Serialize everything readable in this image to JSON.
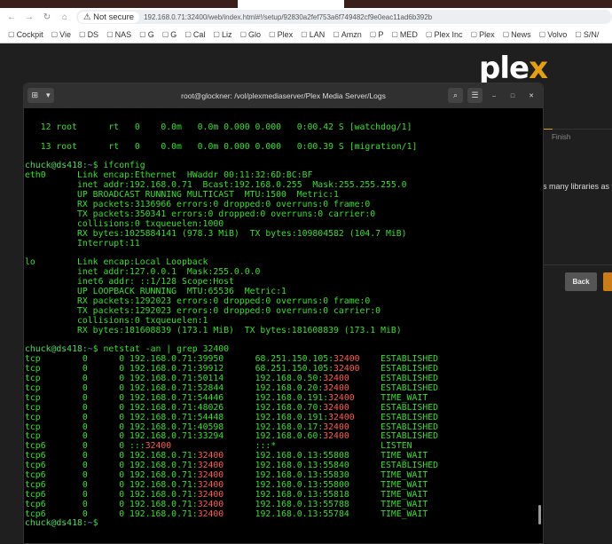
{
  "browser": {
    "not_secure": "Not secure",
    "url": "192.168.0.71:32400/web/index.html#!/setup/92830a2fef753a6f749482cf9e0eac11ad6b392b",
    "bookmarks": [
      "Cockpit",
      "Vie",
      "DS",
      "NAS",
      "G",
      "G",
      "Cal",
      "Liz",
      "Glo",
      "Plex",
      "LAN",
      "Amzn",
      "P",
      "MED",
      "Plex Inc",
      "Plex",
      "News",
      "Volvo",
      "S/N/"
    ]
  },
  "plex": {
    "logo_pre": "ple",
    "logo_x": "x",
    "finish": "Finish",
    "description": "s many libraries as you wa",
    "back": "Back"
  },
  "terminal": {
    "title": "root@glockner: /vol/plexmediaserver/Plex Media Server/Logs",
    "prompt_user": "chuck@ds418",
    "prompt_tilde": ":~$",
    "pre_lines": [
      "",
      "   12 root      rt   0    0.0m   0.0m 0.000 0.000   0:00.42 S [watchdog/1]",
      "",
      "   13 root      rt   0    0.0m   0.0m 0.000 0.000   0:00.39 S [migration/1]",
      ""
    ],
    "cmd1": " ifconfig",
    "ifconfig": [
      "eth0      Link encap:Ethernet  HWaddr 00:11:32:6D:BC:BF",
      "          inet addr:192.168.0.71  Bcast:192.168.0.255  Mask:255.255.255.0",
      "          UP BROADCAST RUNNING MULTICAST  MTU:1500  Metric:1",
      "          RX packets:3136966 errors:0 dropped:0 overruns:0 frame:0",
      "          TX packets:350341 errors:0 dropped:0 overruns:0 carrier:0",
      "          collisions:0 txqueuelen:1000",
      "          RX bytes:1025884141 (978.3 MiB)  TX bytes:109804582 (104.7 MiB)",
      "          Interrupt:11",
      "",
      "lo        Link encap:Local Loopback",
      "          inet addr:127.0.0.1  Mask:255.0.0.0",
      "          inet6 addr: ::1/128 Scope:Host",
      "          UP LOOPBACK RUNNING  MTU:65536  Metric:1",
      "          RX packets:1292023 errors:0 dropped:0 overruns:0 frame:0",
      "          TX packets:1292023 errors:0 dropped:0 overruns:0 carrier:0",
      "          collisions:0 txqueuelen:1",
      "          RX bytes:181608839 (173.1 MiB)  TX bytes:181608839 (173.1 MiB)",
      ""
    ],
    "cmd2": " netstat -an | grep 32400",
    "highlight": "32400",
    "netstat": [
      [
        "tcp",
        "0",
        "0",
        "192.168.0.71:39950",
        "68.251.150.105:32400",
        "ESTABLISHED"
      ],
      [
        "tcp",
        "0",
        "0",
        "192.168.0.71:39912",
        "68.251.150.105:32400",
        "ESTABLISHED"
      ],
      [
        "tcp",
        "0",
        "0",
        "192.168.0.71:50114",
        "192.168.0.50:32400",
        "ESTABLISHED"
      ],
      [
        "tcp",
        "0",
        "0",
        "192.168.0.71:52844",
        "192.168.0.20:32400",
        "ESTABLISHED"
      ],
      [
        "tcp",
        "0",
        "0",
        "192.168.0.71:54446",
        "192.168.0.191:32400",
        "TIME_WAIT"
      ],
      [
        "tcp",
        "0",
        "0",
        "192.168.0.71:48026",
        "192.168.0.70:32400",
        "ESTABLISHED"
      ],
      [
        "tcp",
        "0",
        "0",
        "192.168.0.71:54448",
        "192.168.0.191:32400",
        "ESTABLISHED"
      ],
      [
        "tcp",
        "0",
        "0",
        "192.168.0.71:40598",
        "192.168.0.17:32400",
        "ESTABLISHED"
      ],
      [
        "tcp",
        "0",
        "0",
        "192.168.0.71:33294",
        "192.168.0.60:32400",
        "ESTABLISHED"
      ],
      [
        "tcp6",
        "0",
        "0",
        ":::32400",
        ":::*",
        "LISTEN"
      ],
      [
        "tcp6",
        "0",
        "0",
        "192.168.0.71:32400",
        "192.168.0.13:55808",
        "TIME_WAIT"
      ],
      [
        "tcp6",
        "0",
        "0",
        "192.168.0.71:32400",
        "192.168.0.13:55840",
        "ESTABLISHED"
      ],
      [
        "tcp6",
        "0",
        "0",
        "192.168.0.71:32400",
        "192.168.0.13:55830",
        "TIME_WAIT"
      ],
      [
        "tcp6",
        "0",
        "0",
        "192.168.0.71:32400",
        "192.168.0.13:55800",
        "TIME_WAIT"
      ],
      [
        "tcp6",
        "0",
        "0",
        "192.168.0.71:32400",
        "192.168.0.13:55818",
        "TIME_WAIT"
      ],
      [
        "tcp6",
        "0",
        "0",
        "192.168.0.71:32400",
        "192.168.0.13:55788",
        "TIME_WAIT"
      ],
      [
        "tcp6",
        "0",
        "0",
        "192.168.0.71:32400",
        "192.168.0.13:55784",
        "TIME_WAIT"
      ]
    ]
  }
}
